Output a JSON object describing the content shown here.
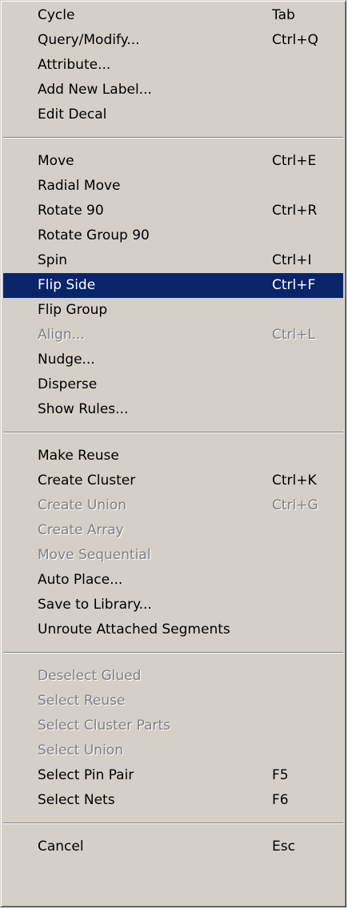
{
  "menu": {
    "groups": [
      [
        {
          "label": "Cycle",
          "shortcut": "Tab",
          "enabled": true
        },
        {
          "label": "Query/Modify...",
          "shortcut": "Ctrl+Q",
          "enabled": true
        },
        {
          "label": "Attribute...",
          "shortcut": "",
          "enabled": true
        },
        {
          "label": "Add New Label...",
          "shortcut": "",
          "enabled": true
        },
        {
          "label": "Edit Decal",
          "shortcut": "",
          "enabled": true
        }
      ],
      [
        {
          "label": "Move",
          "shortcut": "Ctrl+E",
          "enabled": true
        },
        {
          "label": "Radial Move",
          "shortcut": "",
          "enabled": true
        },
        {
          "label": "Rotate 90",
          "shortcut": "Ctrl+R",
          "enabled": true
        },
        {
          "label": "Rotate Group 90",
          "shortcut": "",
          "enabled": true
        },
        {
          "label": "Spin",
          "shortcut": "Ctrl+I",
          "enabled": true
        },
        {
          "label": "Flip Side",
          "shortcut": "Ctrl+F",
          "enabled": true,
          "selected": true
        },
        {
          "label": "Flip Group",
          "shortcut": "",
          "enabled": true
        },
        {
          "label": "Align...",
          "shortcut": "Ctrl+L",
          "enabled": false
        },
        {
          "label": "Nudge...",
          "shortcut": "",
          "enabled": true
        },
        {
          "label": "Disperse",
          "shortcut": "",
          "enabled": true
        },
        {
          "label": "Show Rules...",
          "shortcut": "",
          "enabled": true
        }
      ],
      [
        {
          "label": "Make Reuse",
          "shortcut": "",
          "enabled": true
        },
        {
          "label": "Create Cluster",
          "shortcut": "Ctrl+K",
          "enabled": true
        },
        {
          "label": "Create Union",
          "shortcut": "Ctrl+G",
          "enabled": false
        },
        {
          "label": "Create Array",
          "shortcut": "",
          "enabled": false
        },
        {
          "label": "Move Sequential",
          "shortcut": "",
          "enabled": false
        },
        {
          "label": "Auto Place...",
          "shortcut": "",
          "enabled": true
        },
        {
          "label": "Save to Library...",
          "shortcut": "",
          "enabled": true
        },
        {
          "label": "Unroute Attached Segments",
          "shortcut": "",
          "enabled": true
        }
      ],
      [
        {
          "label": "Deselect Glued",
          "shortcut": "",
          "enabled": false
        },
        {
          "label": "Select Reuse",
          "shortcut": "",
          "enabled": false
        },
        {
          "label": "Select Cluster Parts",
          "shortcut": "",
          "enabled": false
        },
        {
          "label": "Select Union",
          "shortcut": "",
          "enabled": false
        },
        {
          "label": "Select Pin Pair",
          "shortcut": "F5",
          "enabled": true
        },
        {
          "label": "Select Nets",
          "shortcut": "F6",
          "enabled": true
        }
      ],
      [
        {
          "label": "Cancel",
          "shortcut": "Esc",
          "enabled": true
        }
      ]
    ]
  },
  "colors": {
    "menu_background": "#d4d0c8",
    "selection_background": "#0a246a",
    "selection_text": "#ffffff",
    "disabled_text": "#808080"
  }
}
